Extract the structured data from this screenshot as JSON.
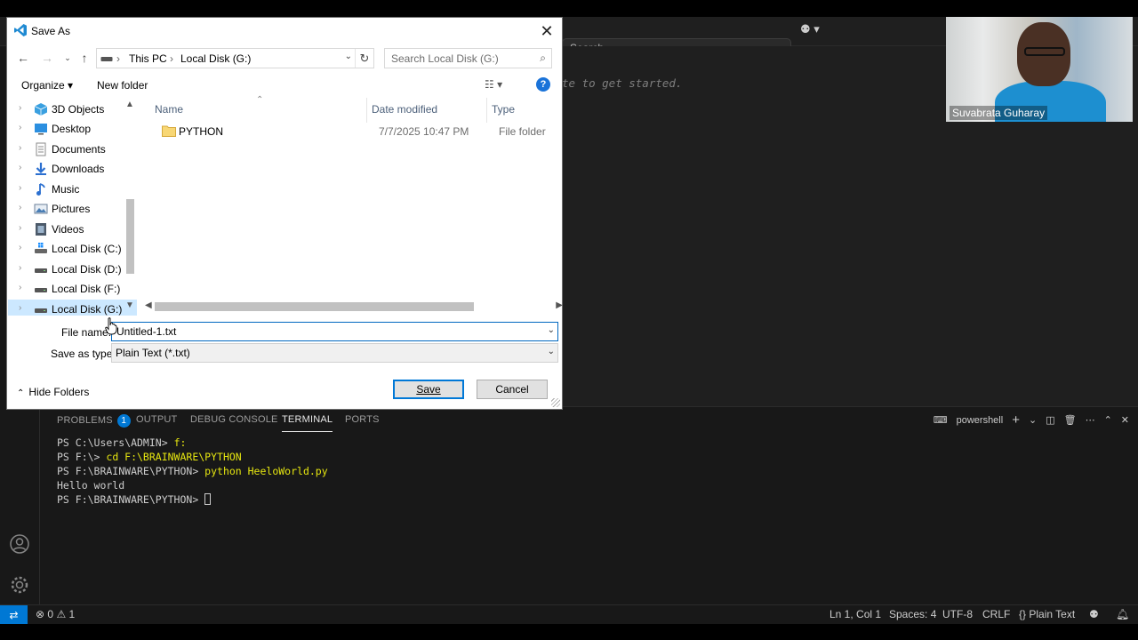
{
  "vscode": {
    "search_placeholder": "Search",
    "editor_hint": "te to get started.",
    "panel": {
      "tabs": [
        {
          "label": "PROBLEMS",
          "badge": "1"
        },
        {
          "label": "OUTPUT"
        },
        {
          "label": "DEBUG CONSOLE"
        },
        {
          "label": "TERMINAL",
          "active": true
        },
        {
          "label": "PORTS"
        }
      ],
      "terminal_name": "powershell",
      "terminal_lines": [
        {
          "prompt": "PS C:\\Users\\ADMIN> ",
          "cmd": "f:"
        },
        {
          "prompt": "PS F:\\> ",
          "cmd": "cd F:\\BRAINWARE\\PYTHON"
        },
        {
          "prompt": "PS F:\\BRAINWARE\\PYTHON> ",
          "cmd": "python HeeloWorld.py"
        },
        {
          "prompt": "Hello world",
          "cmd": ""
        },
        {
          "prompt": "PS F:\\BRAINWARE\\PYTHON> ",
          "cmd": ""
        }
      ]
    },
    "status": {
      "errors": "0",
      "warnings": "1",
      "position": "Ln 1, Col 1",
      "spaces": "Spaces: 4",
      "encoding": "UTF-8",
      "eol": "CRLF",
      "language": "Plain Text"
    },
    "accent": "#0078d4"
  },
  "webcam": {
    "name": "Suvabrata Guharay"
  },
  "dialog": {
    "title": "Save As",
    "close_glyph": "✕",
    "breadcrumb": [
      "This PC",
      "Local Disk (G:)"
    ],
    "search_placeholder": "Search Local Disk (G:)",
    "organize_label": "Organize ▾",
    "new_folder_label": "New folder",
    "tree": [
      {
        "label": "3D Objects",
        "icon": "3d-objects-icon"
      },
      {
        "label": "Desktop",
        "icon": "desktop-icon"
      },
      {
        "label": "Documents",
        "icon": "documents-icon"
      },
      {
        "label": "Downloads",
        "icon": "downloads-icon"
      },
      {
        "label": "Music",
        "icon": "music-icon"
      },
      {
        "label": "Pictures",
        "icon": "pictures-icon"
      },
      {
        "label": "Videos",
        "icon": "videos-icon"
      },
      {
        "label": "Local Disk (C:)",
        "icon": "system-drive-icon"
      },
      {
        "label": "Local Disk (D:)",
        "icon": "drive-icon"
      },
      {
        "label": "Local Disk (F:)",
        "icon": "drive-icon"
      },
      {
        "label": "Local Disk (G:)",
        "icon": "drive-icon",
        "selected": true
      }
    ],
    "columns": {
      "name": "Name",
      "date": "Date modified",
      "type": "Type"
    },
    "files": [
      {
        "name": "PYTHON",
        "date": "7/7/2025 10:47 PM",
        "type": "File folder"
      }
    ],
    "file_name_label": "File name:",
    "file_name_value": "Untitled-1.txt",
    "save_type_label": "Save as type:",
    "save_type_value": "Plain Text (*.txt)",
    "hide_folders_label": "Hide Folders",
    "save_label": "Save",
    "cancel_label": "Cancel"
  }
}
